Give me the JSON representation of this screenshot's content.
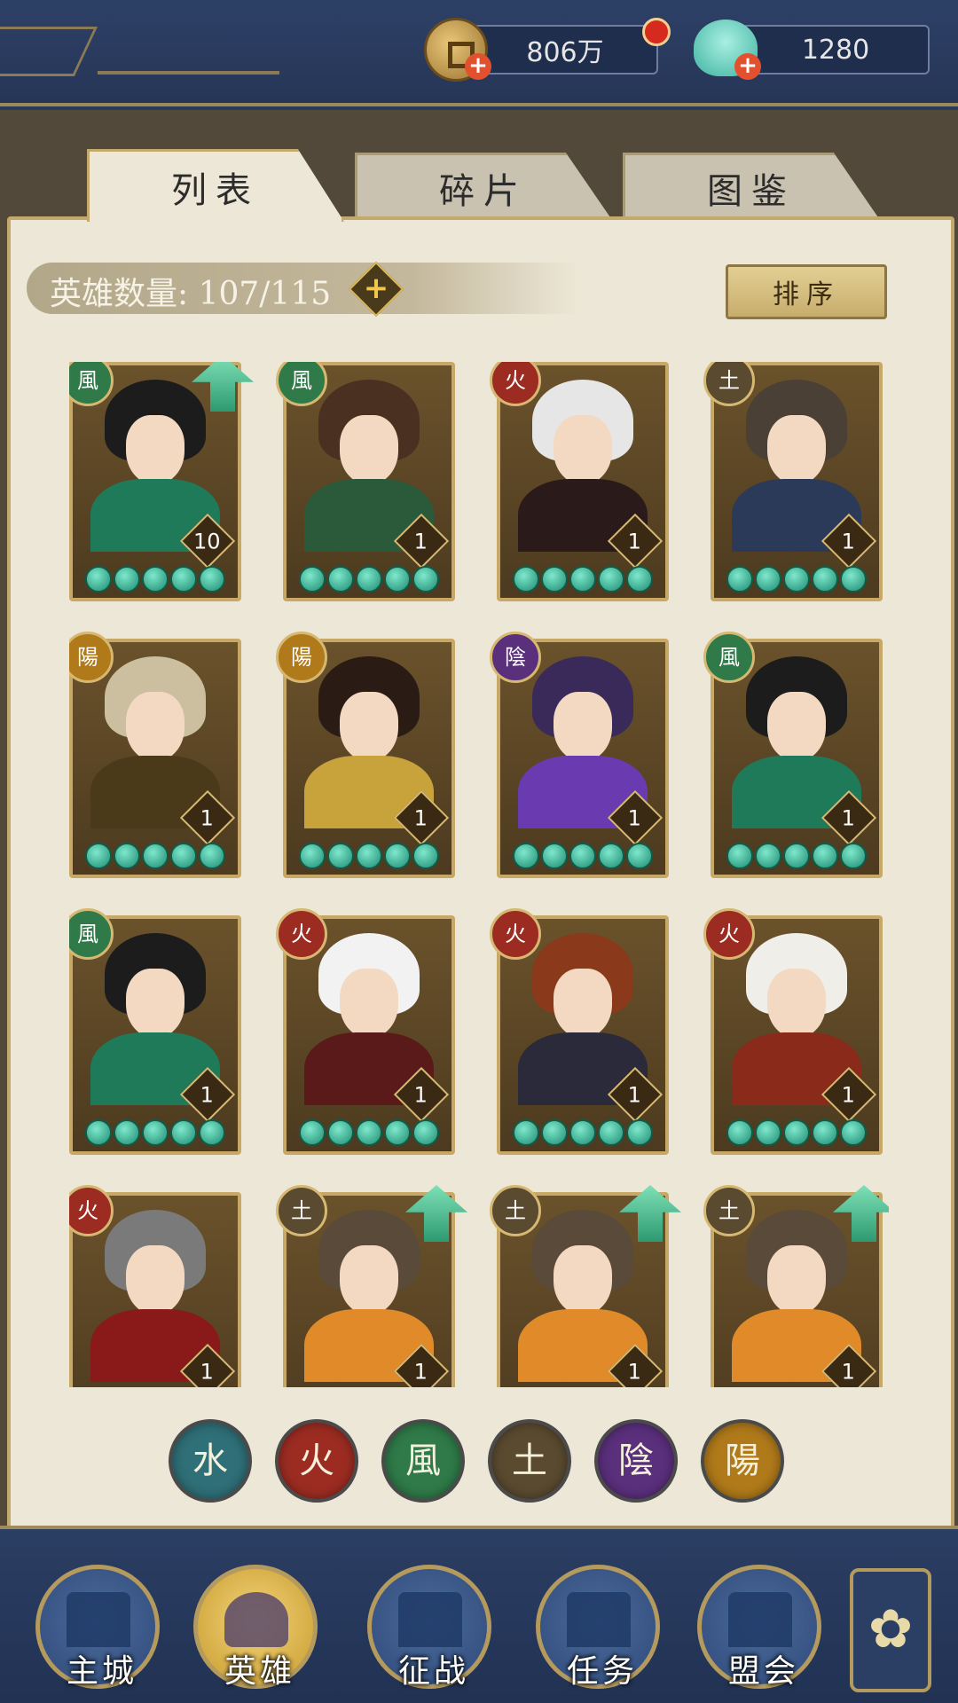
{
  "resources": {
    "coins": "806万",
    "shells": "1280"
  },
  "tabs": [
    "列表",
    "碎片",
    "图鉴"
  ],
  "hero_count_label": "英雄数量: 107/115",
  "sort_label": "排序",
  "plus_symbol": "+",
  "colors": {
    "water": "#2f6f77",
    "fire": "#9c2c22",
    "wind": "#2f7a48",
    "earth": "#5a4a30",
    "yin": "#5a2f7c",
    "yang": "#b07a1a"
  },
  "heroes": [
    {
      "element_glyph": "風",
      "element": "wind",
      "level": "10",
      "upgrade": true,
      "hair": "#1c1c1c",
      "outfit": "#1f7a5a"
    },
    {
      "element_glyph": "風",
      "element": "wind",
      "level": "1",
      "upgrade": false,
      "hair": "#4a3020",
      "outfit": "#2a5a3a"
    },
    {
      "element_glyph": "火",
      "element": "fire",
      "level": "1",
      "upgrade": false,
      "hair": "#e6e6e6",
      "outfit": "#2a1a1a"
    },
    {
      "element_glyph": "土",
      "element": "earth",
      "level": "1",
      "upgrade": false,
      "hair": "#4a4036",
      "outfit": "#2c3a5a"
    },
    {
      "element_glyph": "陽",
      "element": "yang",
      "level": "1",
      "upgrade": false,
      "hair": "#cbbf9f",
      "outfit": "#4a3a1a"
    },
    {
      "element_glyph": "陽",
      "element": "yang",
      "level": "1",
      "upgrade": false,
      "hair": "#2a1c14",
      "outfit": "#c8a23a"
    },
    {
      "element_glyph": "陰",
      "element": "yin",
      "level": "1",
      "upgrade": false,
      "hair": "#3a2a5a",
      "outfit": "#6a3ab0"
    },
    {
      "element_glyph": "風",
      "element": "wind",
      "level": "1",
      "upgrade": false,
      "hair": "#1c1c1c",
      "outfit": "#1f7a5a"
    },
    {
      "element_glyph": "風",
      "element": "wind",
      "level": "1",
      "upgrade": false,
      "hair": "#1c1c1c",
      "outfit": "#1f7a5a"
    },
    {
      "element_glyph": "火",
      "element": "fire",
      "level": "1",
      "upgrade": false,
      "hair": "#f2f2f2",
      "outfit": "#5a1a1a"
    },
    {
      "element_glyph": "火",
      "element": "fire",
      "level": "1",
      "upgrade": false,
      "hair": "#8a3a1a",
      "outfit": "#2a2a3a"
    },
    {
      "element_glyph": "火",
      "element": "fire",
      "level": "1",
      "upgrade": false,
      "hair": "#f0eee8",
      "outfit": "#8a2a1a"
    },
    {
      "element_glyph": "火",
      "element": "fire",
      "level": "1",
      "upgrade": false,
      "hair": "#7a7a7a",
      "outfit": "#8a1a1a"
    },
    {
      "element_glyph": "土",
      "element": "earth",
      "level": "1",
      "upgrade": true,
      "hair": "#5a4a3a",
      "outfit": "#e08a2a"
    },
    {
      "element_glyph": "土",
      "element": "earth",
      "level": "1",
      "upgrade": true,
      "hair": "#5a4a3a",
      "outfit": "#e08a2a"
    },
    {
      "element_glyph": "土",
      "element": "earth",
      "level": "1",
      "upgrade": true,
      "hair": "#5a4a3a",
      "outfit": "#e08a2a"
    }
  ],
  "element_filters": [
    {
      "glyph": "水",
      "element": "water"
    },
    {
      "glyph": "火",
      "element": "fire"
    },
    {
      "glyph": "風",
      "element": "wind"
    },
    {
      "glyph": "土",
      "element": "earth"
    },
    {
      "glyph": "陰",
      "element": "yin"
    },
    {
      "glyph": "陽",
      "element": "yang"
    }
  ],
  "nav": [
    {
      "label": "主城",
      "icon": "city-gate-icon",
      "active": false
    },
    {
      "label": "英雄",
      "icon": "hero-portrait-icon",
      "active": true
    },
    {
      "label": "征战",
      "icon": "war-horn-icon",
      "active": false
    },
    {
      "label": "任务",
      "icon": "scroll-icon",
      "active": false
    },
    {
      "label": "盟会",
      "icon": "alliance-hall-icon",
      "active": false
    }
  ],
  "more_icon": "flower-menu-icon"
}
